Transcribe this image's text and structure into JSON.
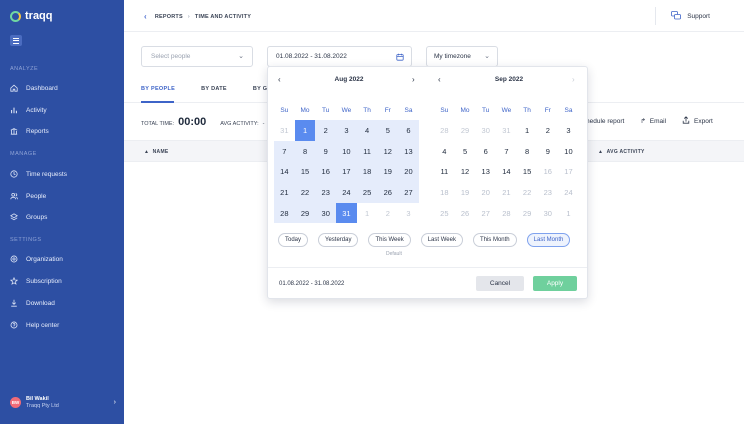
{
  "app": {
    "name": "traqq"
  },
  "sidebar": {
    "sections": {
      "analyze": "ANALYZE",
      "manage": "MANAGE",
      "settings": "SETTINGS"
    },
    "items": [
      {
        "label": "Dashboard",
        "icon": "home-icon"
      },
      {
        "label": "Activity",
        "icon": "bar-chart-icon"
      },
      {
        "label": "Reports",
        "icon": "reports-icon"
      },
      {
        "label": "Time requests",
        "icon": "clock-icon"
      },
      {
        "label": "People",
        "icon": "people-icon"
      },
      {
        "label": "Groups",
        "icon": "layers-icon"
      },
      {
        "label": "Organization",
        "icon": "settings-icon"
      },
      {
        "label": "Subscription",
        "icon": "star-icon"
      },
      {
        "label": "Download",
        "icon": "download-icon"
      },
      {
        "label": "Help center",
        "icon": "help-icon"
      }
    ],
    "user": {
      "initials": "BW",
      "name": "Bil Wakil",
      "org": "Traqq Pty Ltd"
    }
  },
  "header": {
    "breadcrumb": [
      "REPORTS",
      "TIME AND ACTIVITY"
    ],
    "support_label": "Support"
  },
  "filters": {
    "people_placeholder": "Select people",
    "date_range": "01.08.2022 - 31.08.2022",
    "timezone": "My timezone"
  },
  "tabs": [
    "BY PEOPLE",
    "BY DATE",
    "BY GR"
  ],
  "summary": {
    "total_time_label": "TOTAL TIME:",
    "total_time_value": "00:00",
    "avg_activity_label": "AVG ACTIVITY:",
    "avg_activity_value": "-"
  },
  "actions": {
    "schedule": "hedule report",
    "email": "Email",
    "export": "Export"
  },
  "table": {
    "name_header": "NAME",
    "avg_activity_header": "AVG ACTIVITY"
  },
  "datepicker": {
    "weekdays": [
      "Su",
      "Mo",
      "Tu",
      "We",
      "Th",
      "Fr",
      "Sa"
    ],
    "months": [
      {
        "title": "Aug 2022",
        "days": [
          {
            "d": "31",
            "s": "out"
          },
          {
            "d": "1",
            "s": "endpoint"
          },
          {
            "d": "2",
            "s": "range"
          },
          {
            "d": "3",
            "s": "range"
          },
          {
            "d": "4",
            "s": "range"
          },
          {
            "d": "5",
            "s": "range"
          },
          {
            "d": "6",
            "s": "range"
          },
          {
            "d": "7",
            "s": "range"
          },
          {
            "d": "8",
            "s": "range"
          },
          {
            "d": "9",
            "s": "range"
          },
          {
            "d": "10",
            "s": "range"
          },
          {
            "d": "11",
            "s": "range"
          },
          {
            "d": "12",
            "s": "range"
          },
          {
            "d": "13",
            "s": "range"
          },
          {
            "d": "14",
            "s": "range"
          },
          {
            "d": "15",
            "s": "range"
          },
          {
            "d": "16",
            "s": "range"
          },
          {
            "d": "17",
            "s": "range"
          },
          {
            "d": "18",
            "s": "range"
          },
          {
            "d": "19",
            "s": "range"
          },
          {
            "d": "20",
            "s": "range"
          },
          {
            "d": "21",
            "s": "range"
          },
          {
            "d": "22",
            "s": "range"
          },
          {
            "d": "23",
            "s": "range"
          },
          {
            "d": "24",
            "s": "range"
          },
          {
            "d": "25",
            "s": "range"
          },
          {
            "d": "26",
            "s": "range"
          },
          {
            "d": "27",
            "s": "range"
          },
          {
            "d": "28",
            "s": "range"
          },
          {
            "d": "29",
            "s": "range"
          },
          {
            "d": "30",
            "s": "range"
          },
          {
            "d": "31",
            "s": "endpoint"
          },
          {
            "d": "1",
            "s": "out"
          },
          {
            "d": "2",
            "s": "out"
          },
          {
            "d": "3",
            "s": "out"
          }
        ]
      },
      {
        "title": "Sep 2022",
        "days": [
          {
            "d": "28",
            "s": "out"
          },
          {
            "d": "29",
            "s": "out"
          },
          {
            "d": "30",
            "s": "out"
          },
          {
            "d": "31",
            "s": "out"
          },
          {
            "d": "1",
            "s": "normal"
          },
          {
            "d": "2",
            "s": "normal"
          },
          {
            "d": "3",
            "s": "normal"
          },
          {
            "d": "4",
            "s": "normal"
          },
          {
            "d": "5",
            "s": "normal"
          },
          {
            "d": "6",
            "s": "normal"
          },
          {
            "d": "7",
            "s": "normal"
          },
          {
            "d": "8",
            "s": "normal"
          },
          {
            "d": "9",
            "s": "normal"
          },
          {
            "d": "10",
            "s": "normal"
          },
          {
            "d": "11",
            "s": "normal"
          },
          {
            "d": "12",
            "s": "normal"
          },
          {
            "d": "13",
            "s": "normal"
          },
          {
            "d": "14",
            "s": "normal"
          },
          {
            "d": "15",
            "s": "normal"
          },
          {
            "d": "16",
            "s": "muted"
          },
          {
            "d": "17",
            "s": "muted"
          },
          {
            "d": "18",
            "s": "muted"
          },
          {
            "d": "19",
            "s": "muted"
          },
          {
            "d": "20",
            "s": "muted"
          },
          {
            "d": "21",
            "s": "muted"
          },
          {
            "d": "22",
            "s": "muted"
          },
          {
            "d": "23",
            "s": "muted"
          },
          {
            "d": "24",
            "s": "muted"
          },
          {
            "d": "25",
            "s": "muted"
          },
          {
            "d": "26",
            "s": "muted"
          },
          {
            "d": "27",
            "s": "muted"
          },
          {
            "d": "28",
            "s": "muted"
          },
          {
            "d": "29",
            "s": "muted"
          },
          {
            "d": "30",
            "s": "muted"
          },
          {
            "d": "1",
            "s": "muted"
          }
        ]
      }
    ],
    "presets": [
      "Today",
      "Yesterday",
      "This Week",
      "Last Week",
      "This Month",
      "Last Month"
    ],
    "active_preset": "Last Month",
    "default_label": "Default",
    "range_text": "01.08.2022 - 31.08.2022",
    "cancel_label": "Cancel",
    "apply_label": "Apply"
  },
  "colors": {
    "sidebar": "#2d4fa3",
    "accent": "#3e64c8",
    "selected_day": "#5a8bef",
    "range_fill": "#e5ecfb",
    "apply": "#6fd09d"
  }
}
